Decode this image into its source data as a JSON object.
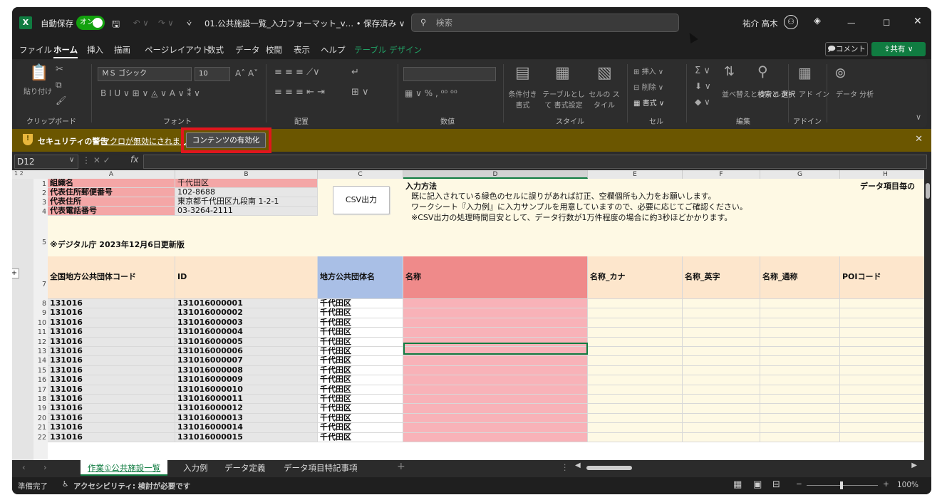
{
  "title_bar": {
    "app_icon": "X",
    "autosave_label": "自動保存",
    "autosave_state": "オン",
    "doc_title": "01.公共施設一覧_入力フォーマット_v…  • 保存済み ∨",
    "search_placeholder": "検索",
    "user_name": "祐介 高木",
    "icons": [
      "save-icon",
      "undo-icon",
      "redo-icon",
      "user-avatar-icon",
      "diamond-icon",
      "minimize-icon",
      "maximize-icon",
      "close-icon"
    ]
  },
  "menu": {
    "items": [
      "ファイル",
      "ホーム",
      "挿入",
      "描画",
      "ページレイアウト",
      "数式",
      "データ",
      "校閲",
      "表示",
      "ヘルプ",
      "テーブル デザイン"
    ],
    "comment_label": "コメント",
    "share_label": "共有"
  },
  "ribbon": {
    "clipboard": {
      "paste": "貼り付け",
      "label": "クリップボード"
    },
    "font": {
      "name": "ＭＳ ゴシック",
      "size": "10",
      "label": "フォント"
    },
    "alignment": {
      "label": "配置"
    },
    "number": {
      "label": "数値"
    },
    "styles": {
      "cond": "条件付き 書式",
      "table": "テーブルとして 書式設定",
      "cell": "セルの スタイル",
      "label": "スタイル"
    },
    "cells": {
      "insert": "挿入",
      "delete": "削除",
      "format": "書式",
      "label": "セル"
    },
    "editing": {
      "sort": "並べ替えと フィルター",
      "find": "検索と 選択",
      "label": "編集"
    },
    "addins": {
      "addin": "アド イン",
      "label": "アドイン"
    },
    "analysis": {
      "label": "データ 分析"
    }
  },
  "security_bar": {
    "title": "セキュリティの警告",
    "message": "マクロが無効にされました。",
    "button": "コンテンツの有効化"
  },
  "formula_bar": {
    "name_box": "D12",
    "fx": "fx",
    "value": ""
  },
  "columns": [
    "A",
    "B",
    "C",
    "D",
    "E",
    "F",
    "G",
    "H"
  ],
  "header_rows": {
    "r1": {
      "label": "組織名",
      "value": "千代田区"
    },
    "r2": {
      "label": "代表住所郵便番号",
      "value": "102-8688"
    },
    "r3": {
      "label": "代表住所",
      "value": "東京都千代田区九段南 1-2-1"
    },
    "r4": {
      "label": "代表電話番号",
      "value": "03-3264-2111"
    },
    "r5": "※デジタル庁 2023年12月6日更新版",
    "csv_button": "CSV出力",
    "instructions_title": "入力方法",
    "instructions": [
      "既に記入されている緑色のセルに誤りがあれば訂正、空欄個所も入力をお願いします。",
      "ワークシート『入力例』に入力サンプルを用意していますので、必要に応じてご確認ください。",
      "※CSV出力の処理時間目安として、データ行数が1万件程度の場合に約3秒ほどかかります。"
    ],
    "h_note": "データ項目毎の"
  },
  "table_headers": [
    "全国地方公共団体コード",
    "ID",
    "地方公共団体名",
    "名称",
    "名称_カナ",
    "名称_英字",
    "名称_通称",
    "POIコード"
  ],
  "rows": [
    {
      "n": "8",
      "code": "131016",
      "id": "131016000001",
      "city": "千代田区"
    },
    {
      "n": "9",
      "code": "131016",
      "id": "131016000002",
      "city": "千代田区"
    },
    {
      "n": "10",
      "code": "131016",
      "id": "131016000003",
      "city": "千代田区"
    },
    {
      "n": "11",
      "code": "131016",
      "id": "131016000004",
      "city": "千代田区"
    },
    {
      "n": "12",
      "code": "131016",
      "id": "131016000005",
      "city": "千代田区"
    },
    {
      "n": "13",
      "code": "131016",
      "id": "131016000006",
      "city": "千代田区"
    },
    {
      "n": "14",
      "code": "131016",
      "id": "131016000007",
      "city": "千代田区"
    },
    {
      "n": "15",
      "code": "131016",
      "id": "131016000008",
      "city": "千代田区"
    },
    {
      "n": "16",
      "code": "131016",
      "id": "131016000009",
      "city": "千代田区"
    },
    {
      "n": "17",
      "code": "131016",
      "id": "131016000010",
      "city": "千代田区"
    },
    {
      "n": "18",
      "code": "131016",
      "id": "131016000011",
      "city": "千代田区"
    },
    {
      "n": "19",
      "code": "131016",
      "id": "131016000012",
      "city": "千代田区"
    },
    {
      "n": "20",
      "code": "131016",
      "id": "131016000013",
      "city": "千代田区"
    },
    {
      "n": "21",
      "code": "131016",
      "id": "131016000014",
      "city": "千代田区"
    },
    {
      "n": "22",
      "code": "131016",
      "id": "131016000015",
      "city": "千代田区"
    }
  ],
  "sheet_tabs": [
    "作業①公共施設一覧",
    "入力例",
    "データ定義",
    "データ項目特記事項"
  ],
  "status": {
    "ready": "準備完了",
    "accessibility": "アクセシビリティ: 検討が必要です",
    "zoom": "100%"
  },
  "colors": {
    "accent": "#107c41",
    "security_bar": "#6b5600",
    "label_red": "#f4a6a6",
    "name_col": "#f8b2b8",
    "header_peach": "#fde6cc",
    "header_blue": "#a9bfe6",
    "header_red": "#ef8a8a",
    "highlight_box": "#e0161d"
  }
}
